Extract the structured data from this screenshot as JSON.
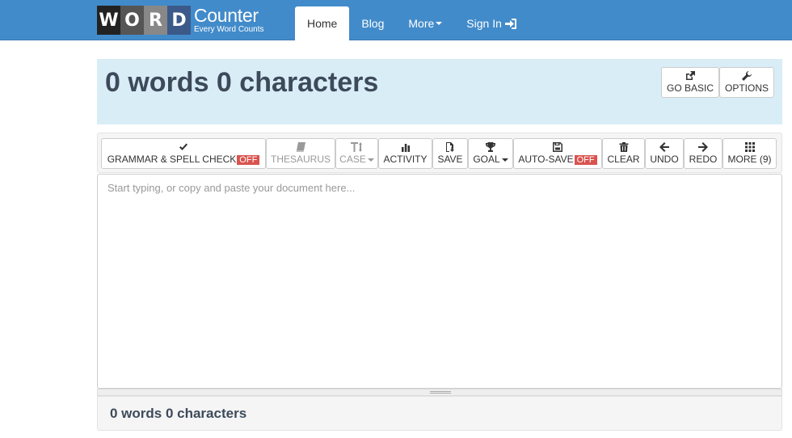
{
  "logo": {
    "letters": [
      "W",
      "O",
      "R",
      "D"
    ],
    "title": "Counter",
    "tagline": "Every Word Counts"
  },
  "nav": {
    "items": [
      {
        "label": "Home",
        "active": true
      },
      {
        "label": "Blog"
      },
      {
        "label": "More",
        "icon": "caret-down-icon"
      },
      {
        "label": "Sign In",
        "icon": "sign-in-icon"
      }
    ]
  },
  "header": {
    "count": "0 words 0 characters",
    "go_basic": {
      "label": "GO BASIC",
      "icon": "external-link-icon"
    },
    "options": {
      "label": "OPTIONS",
      "icon": "wrench-icon"
    }
  },
  "toolbar": {
    "grammar": {
      "label": "GRAMMAR & SPELL CHECK",
      "badge": "OFF",
      "icon": "check-icon"
    },
    "thesaurus": {
      "label": "THESAURUS",
      "icon": "book-icon"
    },
    "case": {
      "label": "CASE",
      "icon": "text-case-icon"
    },
    "activity": {
      "label": "ACTIVITY",
      "icon": "bar-chart-icon"
    },
    "save": {
      "label": "SAVE",
      "icon": "file-download-icon"
    },
    "goal": {
      "label": "GOAL",
      "icon": "trophy-icon"
    },
    "autosave": {
      "label": "AUTO-SAVE",
      "badge": "OFF",
      "icon": "floppy-disk-icon"
    },
    "clear": {
      "label": "CLEAR",
      "icon": "trash-icon"
    },
    "undo": {
      "label": "UNDO",
      "icon": "arrow-left-icon"
    },
    "redo": {
      "label": "REDO",
      "icon": "arrow-right-icon"
    },
    "more": {
      "label": "MORE (9)",
      "icon": "grid-icon"
    }
  },
  "editor": {
    "placeholder": "Start typing, or copy and paste your document here...",
    "value": ""
  },
  "footer": {
    "count": "0 words 0 characters"
  },
  "colors": {
    "navbar": "#428bca",
    "header_panel": "#d9edf7",
    "off_badge": "#d9534f",
    "count_text": "#3d4a5a"
  }
}
